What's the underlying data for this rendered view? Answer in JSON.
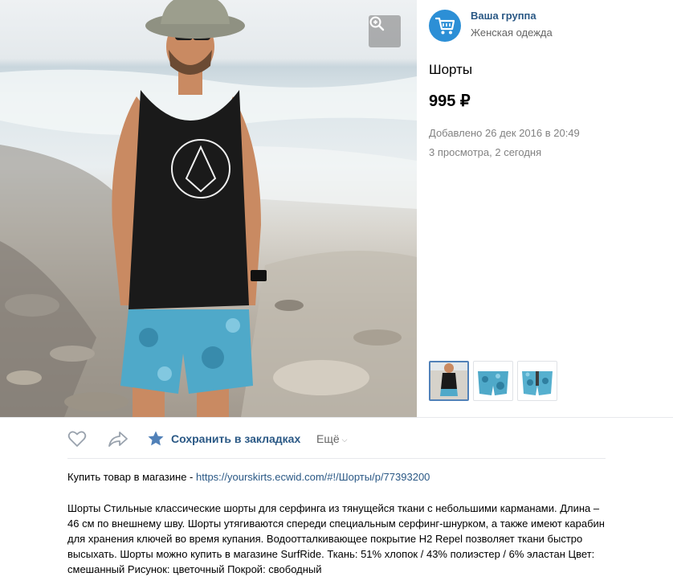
{
  "group": {
    "name": "Ваша группа",
    "subtitle": "Женская одежда",
    "avatar_icon": "shopping-cart-icon"
  },
  "product": {
    "title": "Шорты",
    "price": "995 ₽",
    "added": "Добавлено 26 дек 2016 в 20:49",
    "views": "3 просмотра, 2 сегодня"
  },
  "gallery": {
    "zoom_icon": "zoom-in-icon",
    "selected_thumb": 1,
    "thumb_count": 3
  },
  "actions": {
    "like_icon": "heart-icon",
    "share_icon": "share-arrow-icon",
    "bookmark_icon": "star-icon",
    "bookmark_label": "Сохранить в закладках",
    "more_label": "Ещё",
    "more_icon": "chevron-down-icon"
  },
  "description": {
    "buy_prefix": "Купить товар в магазине - ",
    "buy_link": "https://yourskirts.ecwid.com/#!/Шорты/p/77393200",
    "text": "Шорты Стильные классические шорты для серфинга из тянущейся ткани с небольшими карманами. Длина – 46 см по внешнему шву. Шорты утягиваются спереди специальным серфинг-шнурком, а также имеют карабин для хранения ключей во время купания. Водоотталкивающее покрытие H2 Repel позволяет ткани быстро высыхать. Шорты можно купить в магазине SurfRide. Ткань: 51% хлопок / 43% полиэстер / 6% эластан Цвет: смешанный Рисунок: цветочный Покрой: свободный"
  },
  "colors": {
    "link": "#2a5885",
    "accent": "#5181b8",
    "muted": "#828282",
    "avatar_bg": "#2c8fd6",
    "shorts": "#4fa9c9"
  }
}
